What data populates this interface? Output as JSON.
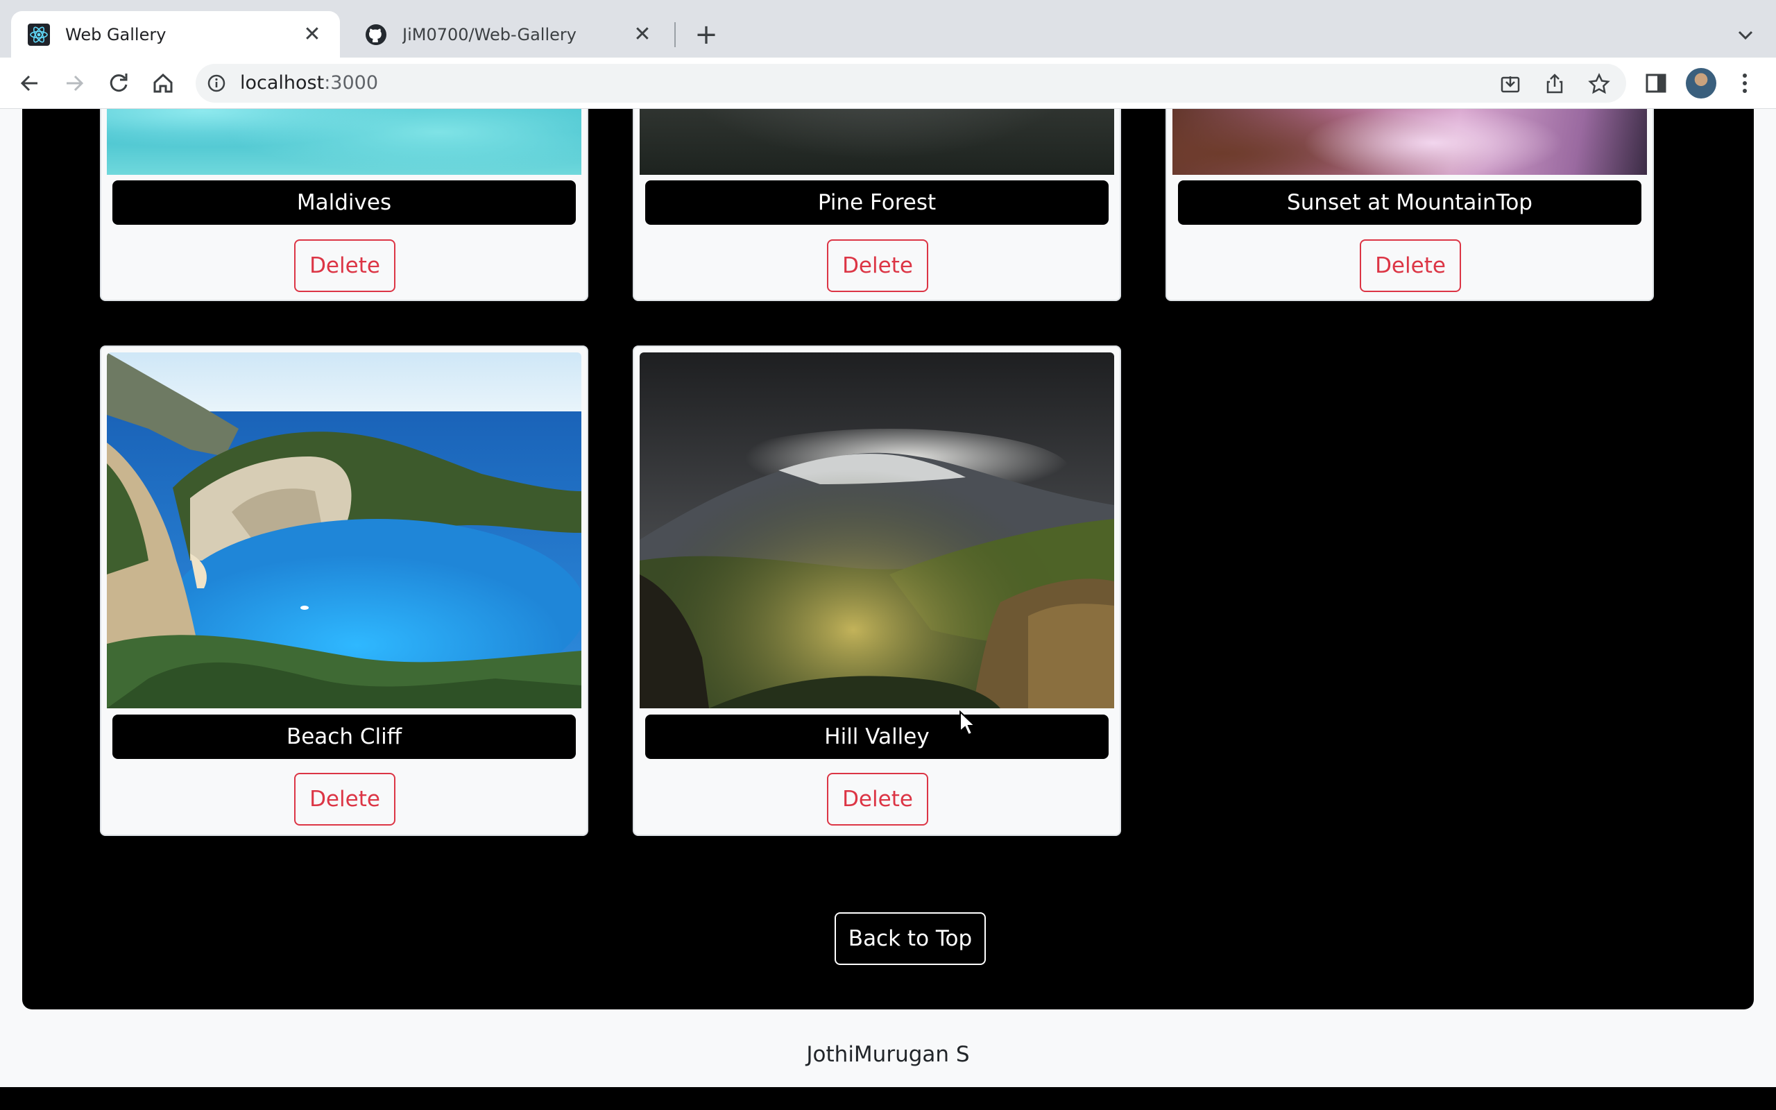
{
  "browser": {
    "tabs": [
      {
        "title": "Web Gallery",
        "icon": "react-icon",
        "active": true
      },
      {
        "title": "JiM0700/Web-Gallery",
        "icon": "github-icon",
        "active": false
      }
    ],
    "address": {
      "host": "localhost",
      "port": ":3000"
    }
  },
  "gallery": {
    "cards": [
      {
        "caption": "Maldives",
        "delete_label": "Delete"
      },
      {
        "caption": "Pine Forest",
        "delete_label": "Delete"
      },
      {
        "caption": "Sunset at MountainTop",
        "delete_label": "Delete"
      },
      {
        "caption": "Beach Cliff",
        "delete_label": "Delete"
      },
      {
        "caption": "Hill Valley",
        "delete_label": "Delete"
      }
    ],
    "back_to_top_label": "Back to Top"
  },
  "footer": {
    "author": "JothiMurugan S"
  },
  "colors": {
    "danger": "#dc3545",
    "panel": "#000000",
    "card": "#f8f9fa"
  }
}
